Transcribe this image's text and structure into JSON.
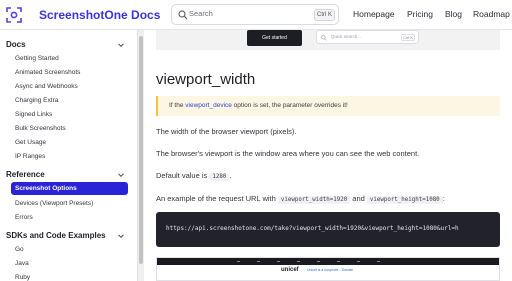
{
  "header": {
    "brand": "ScreenshotOne Docs",
    "search": {
      "placeholder": "Search",
      "shortcut": "Ctrl K"
    },
    "nav": [
      "Homepage",
      "Pricing",
      "Blog",
      "Roadmap"
    ]
  },
  "sidebar": {
    "sections": [
      {
        "title": "Docs",
        "items": [
          "Getting Started",
          "Animated Screenshots",
          "Async and Webhooks",
          "Charging Extra",
          "Signed Links",
          "Bulk Screenshots",
          "Get Usage",
          "IP Ranges"
        ]
      },
      {
        "title": "Reference",
        "active": "Screenshot Options",
        "items": [
          "Devices (Viewport Presets)",
          "Errors"
        ]
      },
      {
        "title": "SDKs and Code Examples",
        "items": [
          "Go",
          "Java",
          "Ruby"
        ]
      }
    ]
  },
  "main": {
    "banner": {
      "button": "Get started",
      "search_placeholder": "Quick search...",
      "search_shortcut": "Ctrl K"
    },
    "title": "viewport_width",
    "callout": {
      "prefix": "If the ",
      "link": "viewport_device",
      "suffix": " option is set, the parameter overrides it!"
    },
    "p1": "The width of the browser viewport (pixels).",
    "p2": "The browser's viewport is the window area where you can see the web content.",
    "p3": {
      "prefix": "Default value is ",
      "code": "1280",
      "suffix": "."
    },
    "p4": {
      "prefix": "An example of the request URL with ",
      "code1": "viewport_width=1920",
      "mid": " and ",
      "code2": "viewport_height=1080",
      "suffix": ":"
    },
    "code": "https://api.screenshotone.com/take?viewport_width=1920&viewport_height=1080&url=h",
    "preview": {
      "brand": "unicef",
      "note": "Unicef is a nonprofit... Donate"
    }
  }
}
